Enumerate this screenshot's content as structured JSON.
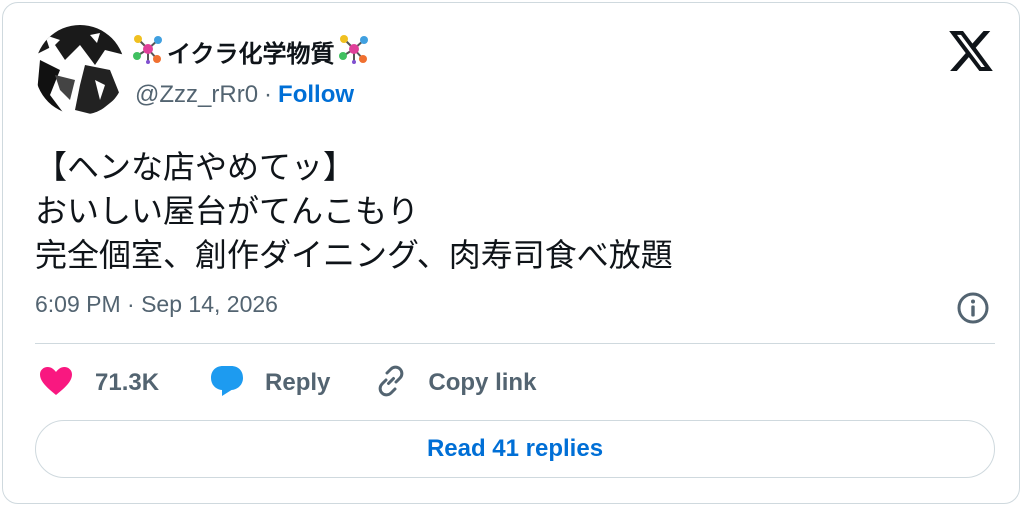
{
  "author": {
    "display_name": "イクラ化学物質",
    "handle": "@Zzz_rRr0",
    "separator": "·",
    "follow_label": "Follow"
  },
  "tweet": {
    "lines": [
      "【ヘンな店やめてッ】",
      "おいしい屋台がてんこもり",
      "完全個室、創作ダイニング、肉寿司食べ放題"
    ],
    "timestamp": "6:09 PM · Sep 14, 2026"
  },
  "actions": {
    "like_count": "71.3K",
    "reply_label": "Reply",
    "copy_link_label": "Copy link"
  },
  "read_replies_label": "Read 41 replies",
  "colors": {
    "link_blue": "#006fd6",
    "secondary_text": "#536471",
    "heart_pink": "#f91880",
    "reply_blue": "#1d9bf0",
    "border": "#cfd9de"
  },
  "icons": [
    "avatar",
    "molecule-emoji-icon",
    "x-logo-icon",
    "info-icon",
    "heart-icon",
    "reply-bubble-icon",
    "link-icon"
  ]
}
